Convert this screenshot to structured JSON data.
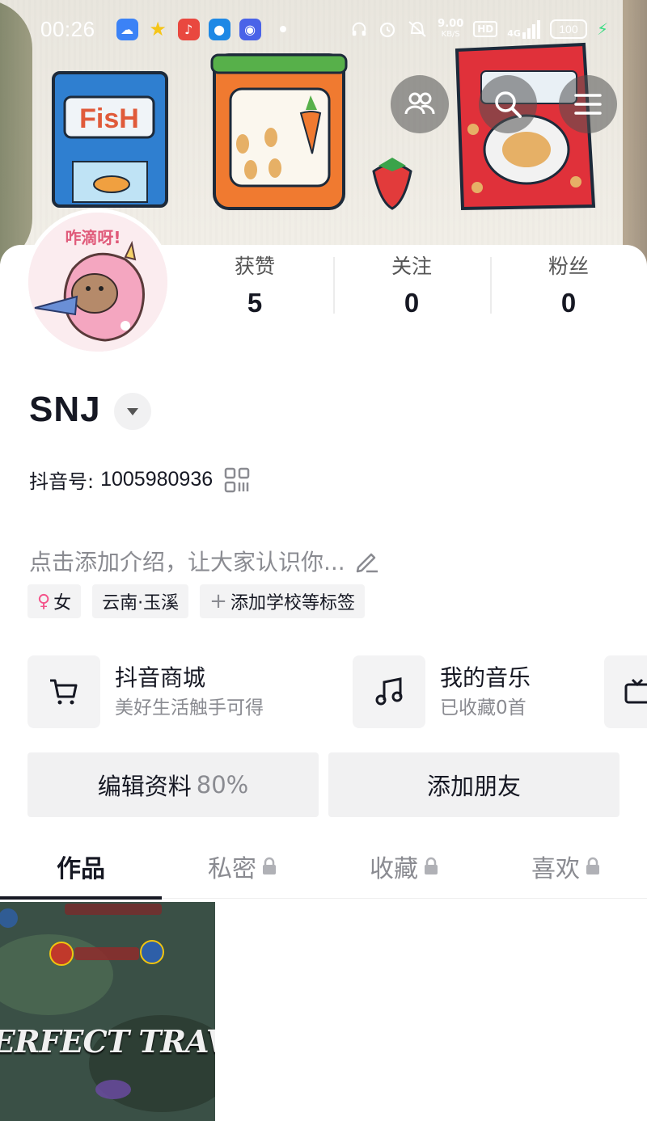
{
  "status_bar": {
    "time": "00:26",
    "net_speed": "9.00",
    "net_unit": "KB/S",
    "hd": "HD",
    "signal": "4G",
    "battery": "100"
  },
  "header": {
    "friends_icon": "people-icon",
    "search_icon": "search-icon",
    "menu_icon": "menu-icon"
  },
  "stats": [
    {
      "label": "获赞",
      "value": "5"
    },
    {
      "label": "关注",
      "value": "0"
    },
    {
      "label": "粉丝",
      "value": "0"
    }
  ],
  "profile": {
    "username": "SNJ",
    "id_label": "抖音号:",
    "id_value": "1005980936",
    "bio_placeholder": "点击添加介绍，让大家认识你...",
    "avatar_text": "咋滴呀!"
  },
  "tags": [
    {
      "label": "女",
      "icon": "female-icon",
      "icon_color": "#f4538a"
    },
    {
      "label": "云南·玉溪"
    },
    {
      "label": "添加学校等标签",
      "prefix": "+"
    }
  ],
  "services": [
    {
      "title": "抖音商城",
      "subtitle": "美好生活触手可得",
      "icon": "cart-icon"
    },
    {
      "title": "我的音乐",
      "subtitle": "已收藏0首",
      "icon": "music-icon"
    },
    {
      "icon": "tv-icon"
    }
  ],
  "actions": {
    "edit_label": "编辑资料",
    "edit_progress": "80%",
    "add_friend_label": "添加朋友"
  },
  "tabs": [
    {
      "label": "作品",
      "active": true
    },
    {
      "label": "私密",
      "locked": true
    },
    {
      "label": "收藏",
      "locked": true
    },
    {
      "label": "喜欢",
      "locked": true
    }
  ],
  "works": [
    {
      "caption": "ERFECT TRAVE"
    }
  ],
  "colors": {
    "text_primary": "#161823",
    "text_secondary": "#8a8b91",
    "button_bg": "#f1f1f2"
  }
}
